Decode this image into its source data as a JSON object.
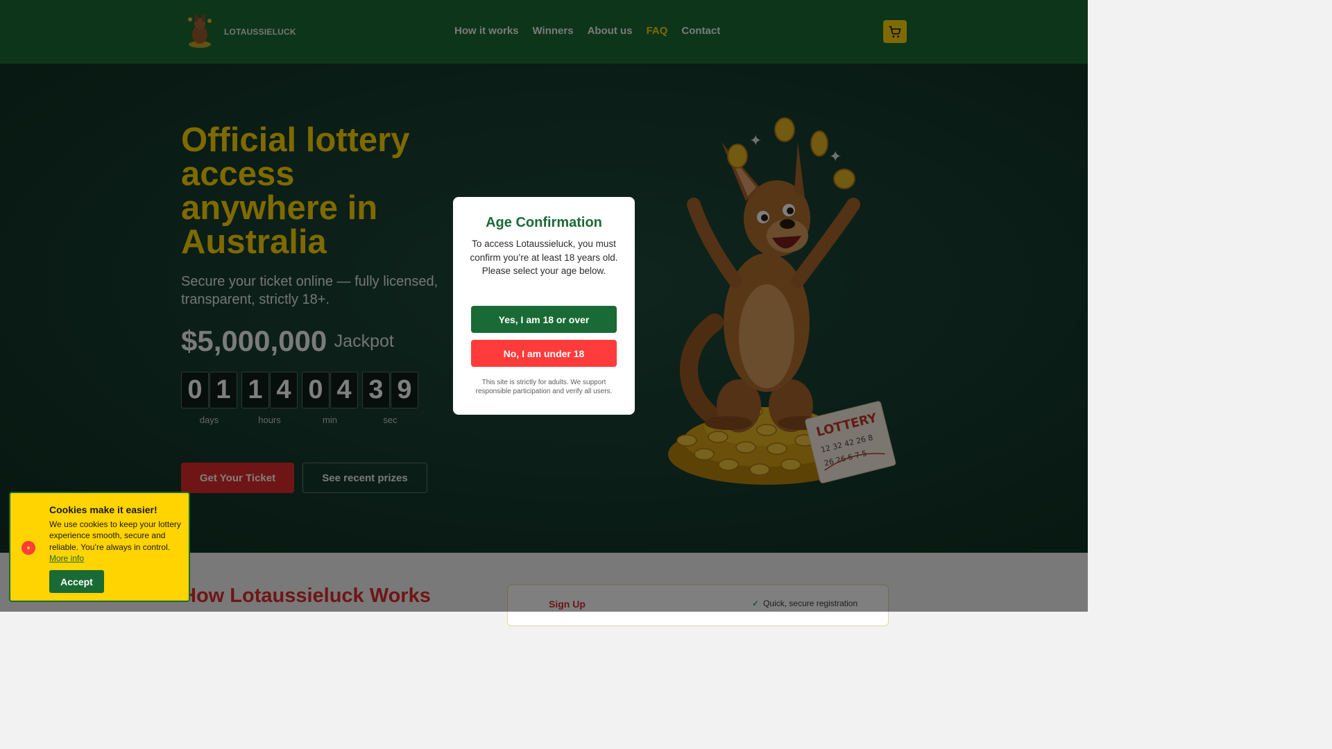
{
  "header": {
    "brand": "LOTAUSSIELUCK",
    "nav": [
      {
        "label": "How it works",
        "active": false
      },
      {
        "label": "Winners",
        "active": false
      },
      {
        "label": "About us",
        "active": false
      },
      {
        "label": "FAQ",
        "active": true
      },
      {
        "label": "Contact",
        "active": false
      }
    ],
    "cart_icon": "cart-icon"
  },
  "hero": {
    "title": "Official lottery access anywhere in Australia",
    "subtitle": "Secure your ticket online — fully licensed, transparent, strictly 18+.",
    "jackpot_amount": "$5,000,000",
    "jackpot_label": "Jackpot",
    "countdown": [
      {
        "digits": [
          "0",
          "1"
        ],
        "label": "days"
      },
      {
        "digits": [
          "1",
          "4"
        ],
        "label": "hours"
      },
      {
        "digits": [
          "0",
          "4"
        ],
        "label": "min"
      },
      {
        "digits": [
          "3",
          "9"
        ],
        "label": "sec"
      }
    ],
    "primary_button": "Get Your Ticket",
    "secondary_button": "See recent prizes",
    "illustration": {
      "ticket_text": "LOTTERY",
      "ticket_numbers": [
        "12 32 42 26 8",
        "26 26 6 7 5"
      ]
    }
  },
  "how_it_works": {
    "title": "How Lotaussieluck Works",
    "step_label": "Sign Up",
    "step_check": "Quick, secure registration"
  },
  "age_modal": {
    "title": "Age Confirmation",
    "text_line1": "To access Lotaussieluck, you must confirm you’re at least 18 years old.",
    "text_line2": "Please select your age below.",
    "yes_button": "Yes, I am 18 or over",
    "no_button": "No, I am under 18",
    "note": "This site is strictly for adults. We support responsible participation and verify all users."
  },
  "cookie_banner": {
    "title": "Cookies make it easier!",
    "text": "We use cookies to keep your lottery experience smooth, secure and reliable. You’re always in control.",
    "link": "More info",
    "accept_button": "Accept"
  },
  "colors": {
    "brand_green": "#1a6a35",
    "accent_yellow": "#ffd400",
    "accent_red": "#e02b2b",
    "no_button_red": "#ff3b3b"
  }
}
